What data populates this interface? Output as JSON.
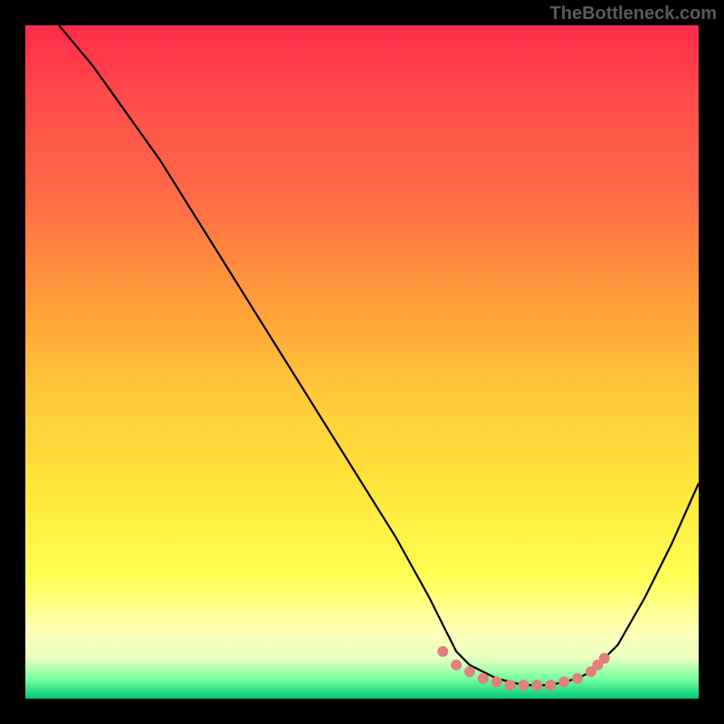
{
  "watermark": "TheBottleneck.com",
  "chart_data": {
    "type": "line",
    "title": "",
    "xlabel": "",
    "ylabel": "",
    "xlim": [
      0,
      100
    ],
    "ylim": [
      0,
      100
    ],
    "gradient_colors": [
      "#ff2a4a",
      "#ff6a48",
      "#ffc93a",
      "#ffff55",
      "#00c878"
    ],
    "series": [
      {
        "name": "curve",
        "x": [
          5,
          10,
          15,
          20,
          25,
          30,
          35,
          40,
          45,
          50,
          55,
          60,
          62,
          64,
          66,
          70,
          74,
          78,
          82,
          84,
          88,
          92,
          96,
          100
        ],
        "values": [
          100,
          94,
          87,
          80,
          72,
          64,
          56,
          48,
          40,
          32,
          24,
          15,
          11,
          7,
          5,
          3,
          2,
          2,
          3,
          4,
          8,
          15,
          23,
          32
        ]
      }
    ],
    "markers": [
      {
        "x": 62,
        "y": 7
      },
      {
        "x": 64,
        "y": 5
      },
      {
        "x": 66,
        "y": 4
      },
      {
        "x": 68,
        "y": 3
      },
      {
        "x": 70,
        "y": 2.5
      },
      {
        "x": 72,
        "y": 2
      },
      {
        "x": 74,
        "y": 2
      },
      {
        "x": 76,
        "y": 2
      },
      {
        "x": 78,
        "y": 2
      },
      {
        "x": 80,
        "y": 2.5
      },
      {
        "x": 82,
        "y": 3
      },
      {
        "x": 84,
        "y": 4
      },
      {
        "x": 85,
        "y": 5
      },
      {
        "x": 86,
        "y": 6
      }
    ],
    "marker_color": "#e28080"
  }
}
